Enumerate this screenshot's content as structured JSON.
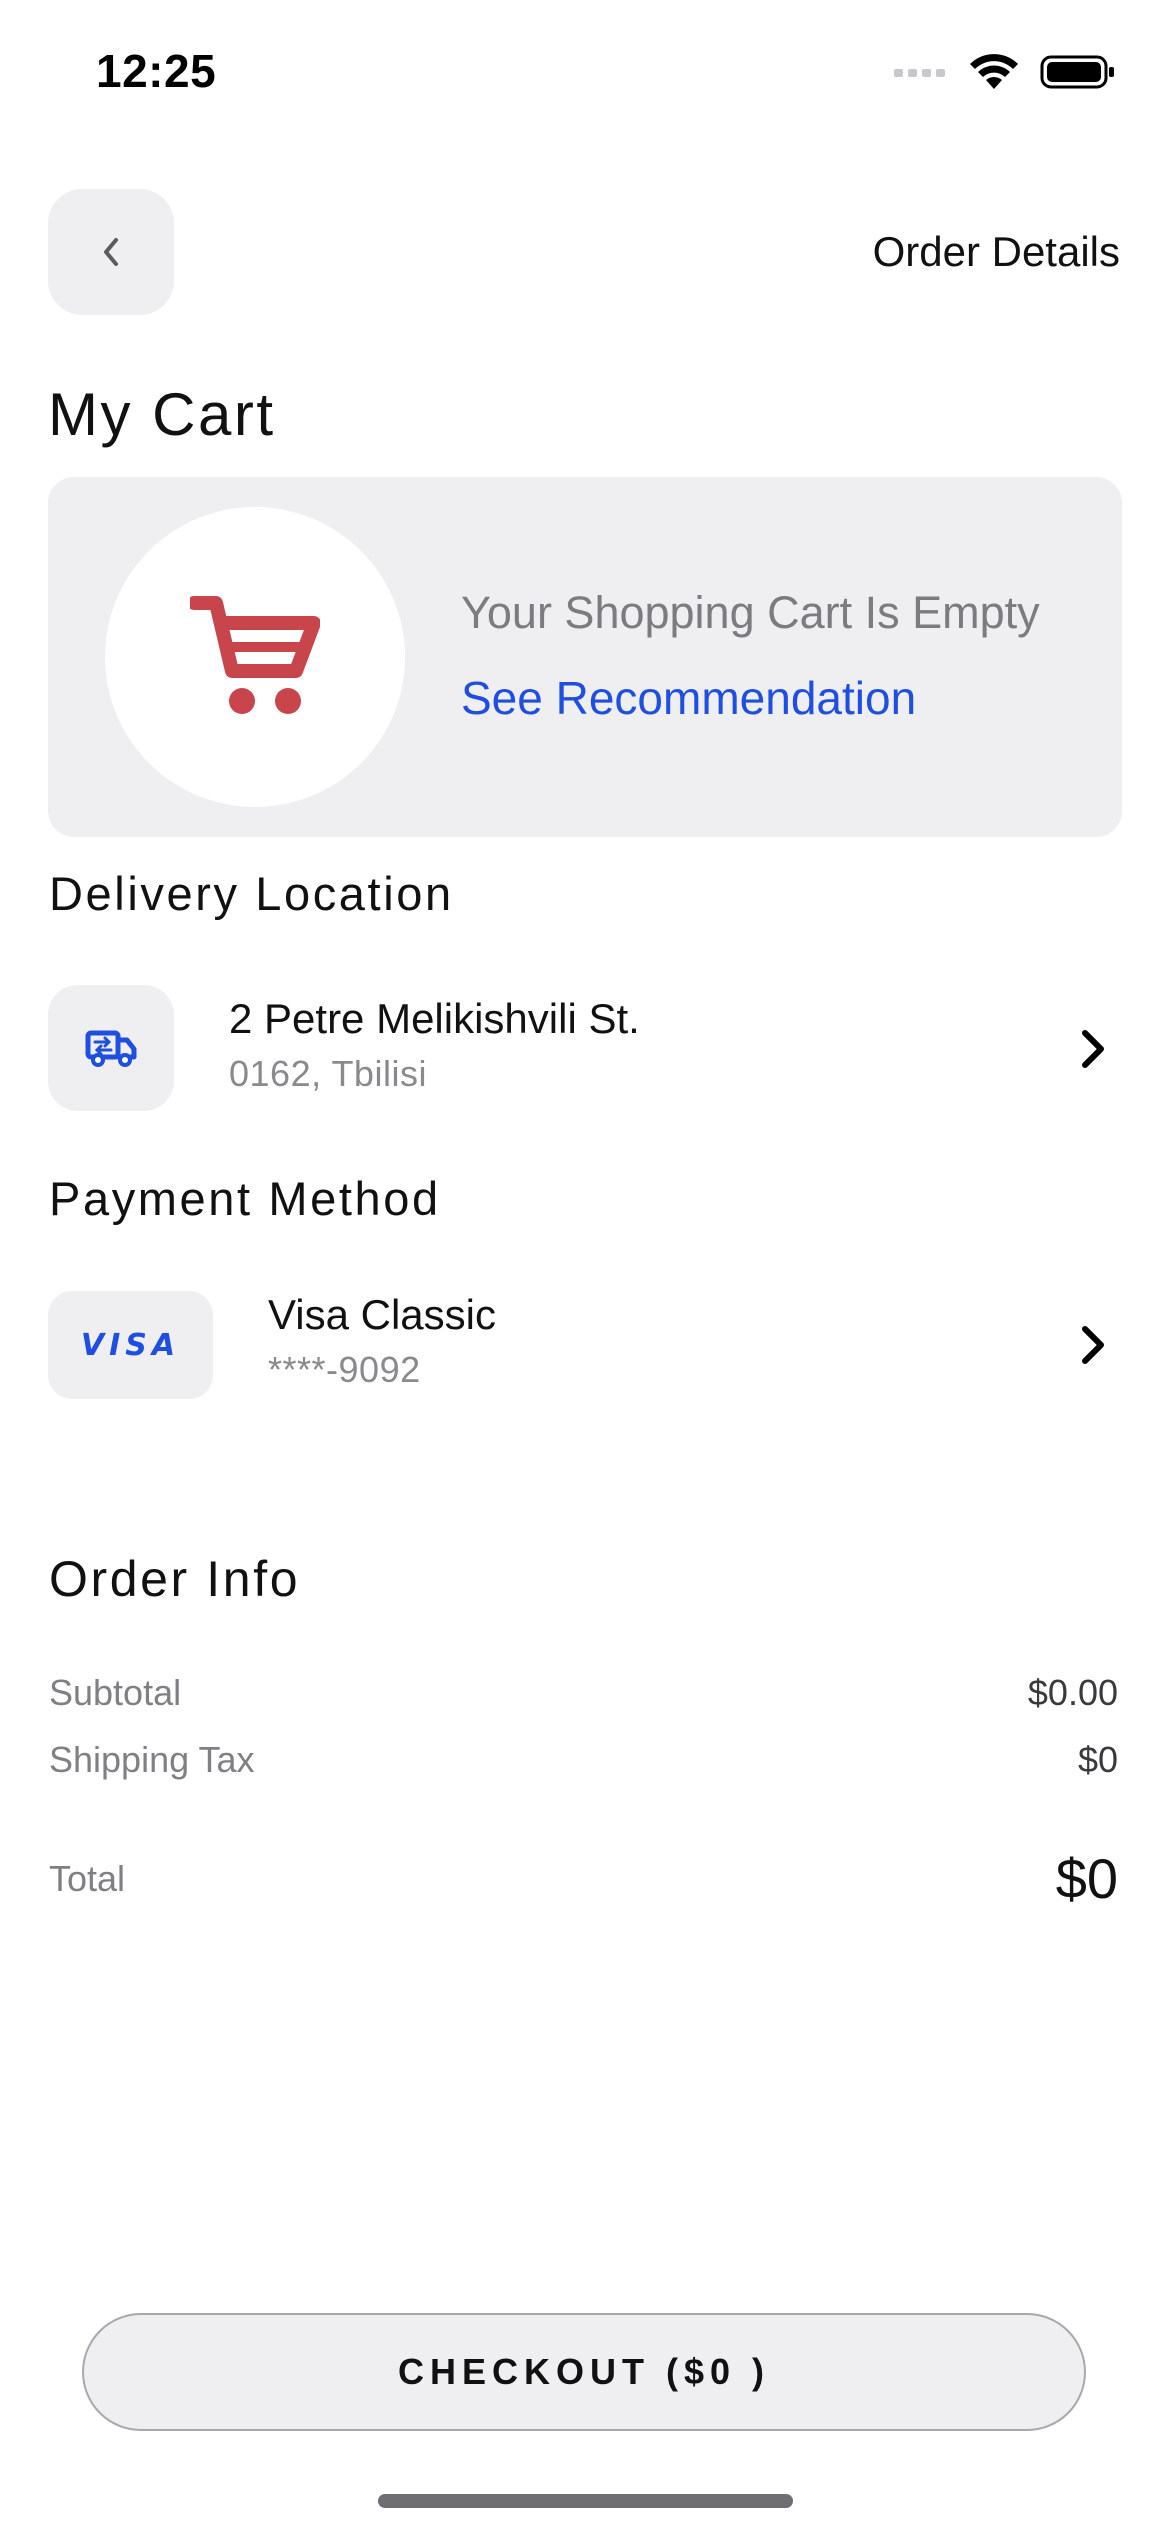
{
  "status_bar": {
    "time": "12:25"
  },
  "header": {
    "title": "Order Details",
    "back_icon": "chevron-left-icon"
  },
  "page_title": "My Cart",
  "cart": {
    "empty_message": "Your Shopping Cart Is Empty",
    "recommendation_link": "See Recommendation",
    "icon": "shopping-cart-icon",
    "icon_color": "#c8454b"
  },
  "delivery": {
    "heading": "Delivery Location",
    "address_line1": "2 Petre Melikishvili St.",
    "address_line2": "0162, Tbilisi",
    "icon": "delivery-truck-icon"
  },
  "payment": {
    "heading": "Payment Method",
    "card_brand": "VISA",
    "card_name": "Visa Classic",
    "card_number": "****-9092"
  },
  "order_info": {
    "heading": "Order Info",
    "subtotal_label": "Subtotal",
    "subtotal_value": "$0.00",
    "shipping_label": "Shipping Tax",
    "shipping_value": "$0",
    "total_label": "Total",
    "total_value": "$0"
  },
  "checkout": {
    "label": "CHECKOUT ($0 )"
  },
  "colors": {
    "accent": "#1f4fe0",
    "tile_bg": "#efeff1",
    "cart_red": "#c8454b"
  }
}
